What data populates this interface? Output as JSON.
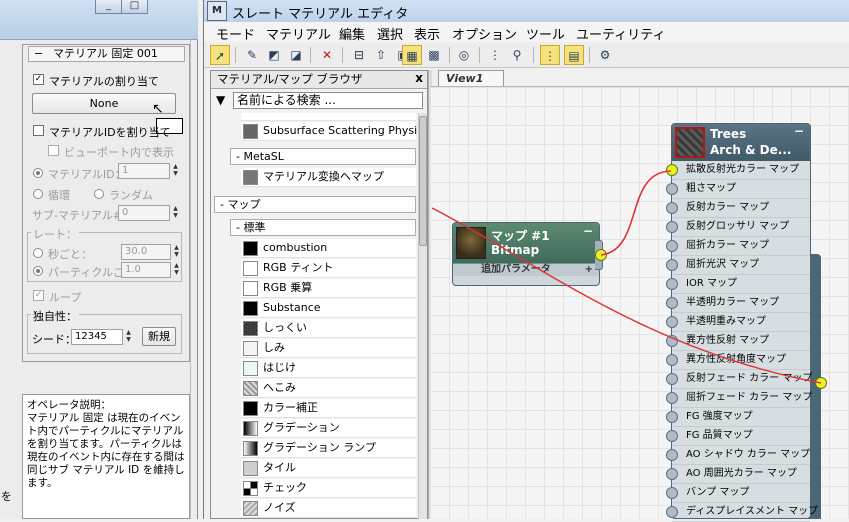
{
  "left_panel": {
    "window_buttons": [
      "_",
      "□"
    ],
    "rollout_title": "マテリアル 固定 001",
    "assign_material_label": "マテリアルの割り当て",
    "material_button_label": "None",
    "assign_material_id_label": "マテリアルIDを割り当て",
    "show_in_viewport_label": "ビューポート内で表示",
    "material_id_label": "マテリアルID：",
    "material_id_value": "1",
    "cycle_label": "循環",
    "random_label": "ランダム",
    "sub_material_label": "サブ-マテリアル#:",
    "sub_material_value": "0",
    "rate_label": "レート：",
    "per_second_label": "秒ごと：",
    "per_second_value": "30.0",
    "per_particle_label": "パーティクルごと：",
    "per_particle_value": "1.0",
    "loop_label": "ループ",
    "uniqueness_label": "独自性：",
    "seed_label": "シード：",
    "seed_value": "12345",
    "new_button_label": "新規",
    "operator_desc_title": "オペレータ説明：",
    "operator_desc_text": "マテリアル 固定 は現在のイベント内でパーティクルにマテリアルを割り当てます。パーティクルは現在のイベント内に存在する間は同じサブ マテリアル ID を維持します。",
    "edge_text": "を"
  },
  "slate": {
    "app_icon": "M",
    "title": "スレート マテリアル エディタ",
    "menu": [
      "モード",
      "マテリアル",
      "編集",
      "選択",
      "表示",
      "オプション",
      "ツール",
      "ユーティリティ"
    ],
    "toolbar_icons": [
      "select-arrow-icon",
      "eyedropper-icon",
      "put-to-scene-icon",
      "assign-to-selection-icon",
      "delete-icon",
      "move-children-icon",
      "hide-unused-icon",
      "show-map-in-viewport-icon",
      "show-background-icon",
      "background-in-preview-icon",
      "sample-uv-icon",
      "layout-all-icon",
      "layout-children-icon",
      "material-map-navigator-icon",
      "parameter-editor-icon",
      "select-by-material-icon"
    ]
  },
  "browser": {
    "title": "マテリアル/マップ ブラウザ",
    "close_label": "x",
    "search_placeholder": "名前による検索 ...",
    "top_items": [
      "Subsurface Scattering Physi..."
    ],
    "metasl_header": "- MetaSL",
    "metasl_items": [
      "マテリアル変換へマップ"
    ],
    "maps_header": "- マップ",
    "standard_header": "- 標準",
    "map_items": [
      "combustion",
      "RGB ティント",
      "RGB 乗算",
      "Substance",
      "しっくい",
      "しみ",
      "はじけ",
      "へこみ",
      "カラー補正",
      "グラデーション",
      "グラデーション ランプ",
      "タイル",
      "チェック",
      "ノイズ"
    ]
  },
  "view": {
    "tab_label": "View1",
    "bitmap_node": {
      "title": "マップ #1",
      "subtitle": "Bitmap",
      "extra_params": "追加パラメータ",
      "minimize": "−",
      "expand": "+"
    },
    "trees_node": {
      "title": "Trees",
      "subtitle": "Arch & De...",
      "minimize": "−",
      "slots": [
        "拡散反射光カラー マップ",
        "粗さマップ",
        "反射カラー マップ",
        "反射グロッサリ マップ",
        "屈折カラー マップ",
        "屈折光沢 マップ",
        "IOR マップ",
        "半透明カラー マップ",
        "半透明重みマップ",
        "異方性反射 マップ",
        "異方性反射角度マップ",
        "反射フェード カラー マップ",
        "屈折フェード カラー マップ",
        "FG 強度マップ",
        "FG 品質マップ",
        "AO シャドウ カラー マップ",
        "AO 周囲光カラー マップ",
        "バンプ マップ",
        "ディスプレイスメント マップ"
      ],
      "connected_slot_index": 0
    }
  },
  "colors": {
    "wire": "#e03030",
    "port_connected": "#e6f225",
    "port_idle": "#aebcc8",
    "toolbar_active": "#f6e27a"
  }
}
